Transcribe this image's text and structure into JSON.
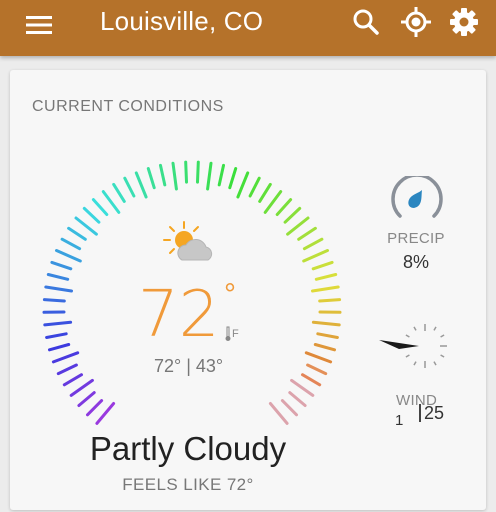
{
  "appbar": {
    "title": "Louisville, CO",
    "background": "#b5722a"
  },
  "icons": {
    "menu": "menu-icon",
    "search": "search-icon",
    "location": "my-location-icon",
    "settings": "gear-icon",
    "weather": "partly-cloudy-icon",
    "thermometer": "thermometer-icon",
    "precip": "raindrop-icon",
    "wind": "wind-arrow-icon"
  },
  "current": {
    "section_title": "CURRENT CONDITIONS",
    "temperature": "72",
    "degree_symbol": "°",
    "unit": "F",
    "hi_lo": "72° | 43°",
    "condition": "Partly Cloudy",
    "feels_like": "FEELS LIKE 72°"
  },
  "precip": {
    "label": "PRECIP",
    "value": "8%"
  },
  "wind": {
    "label": "WIND",
    "speed": "1",
    "gust": "25"
  },
  "colors": {
    "temperature": "#f09a3a",
    "precip_icon": "#2b86c0"
  }
}
